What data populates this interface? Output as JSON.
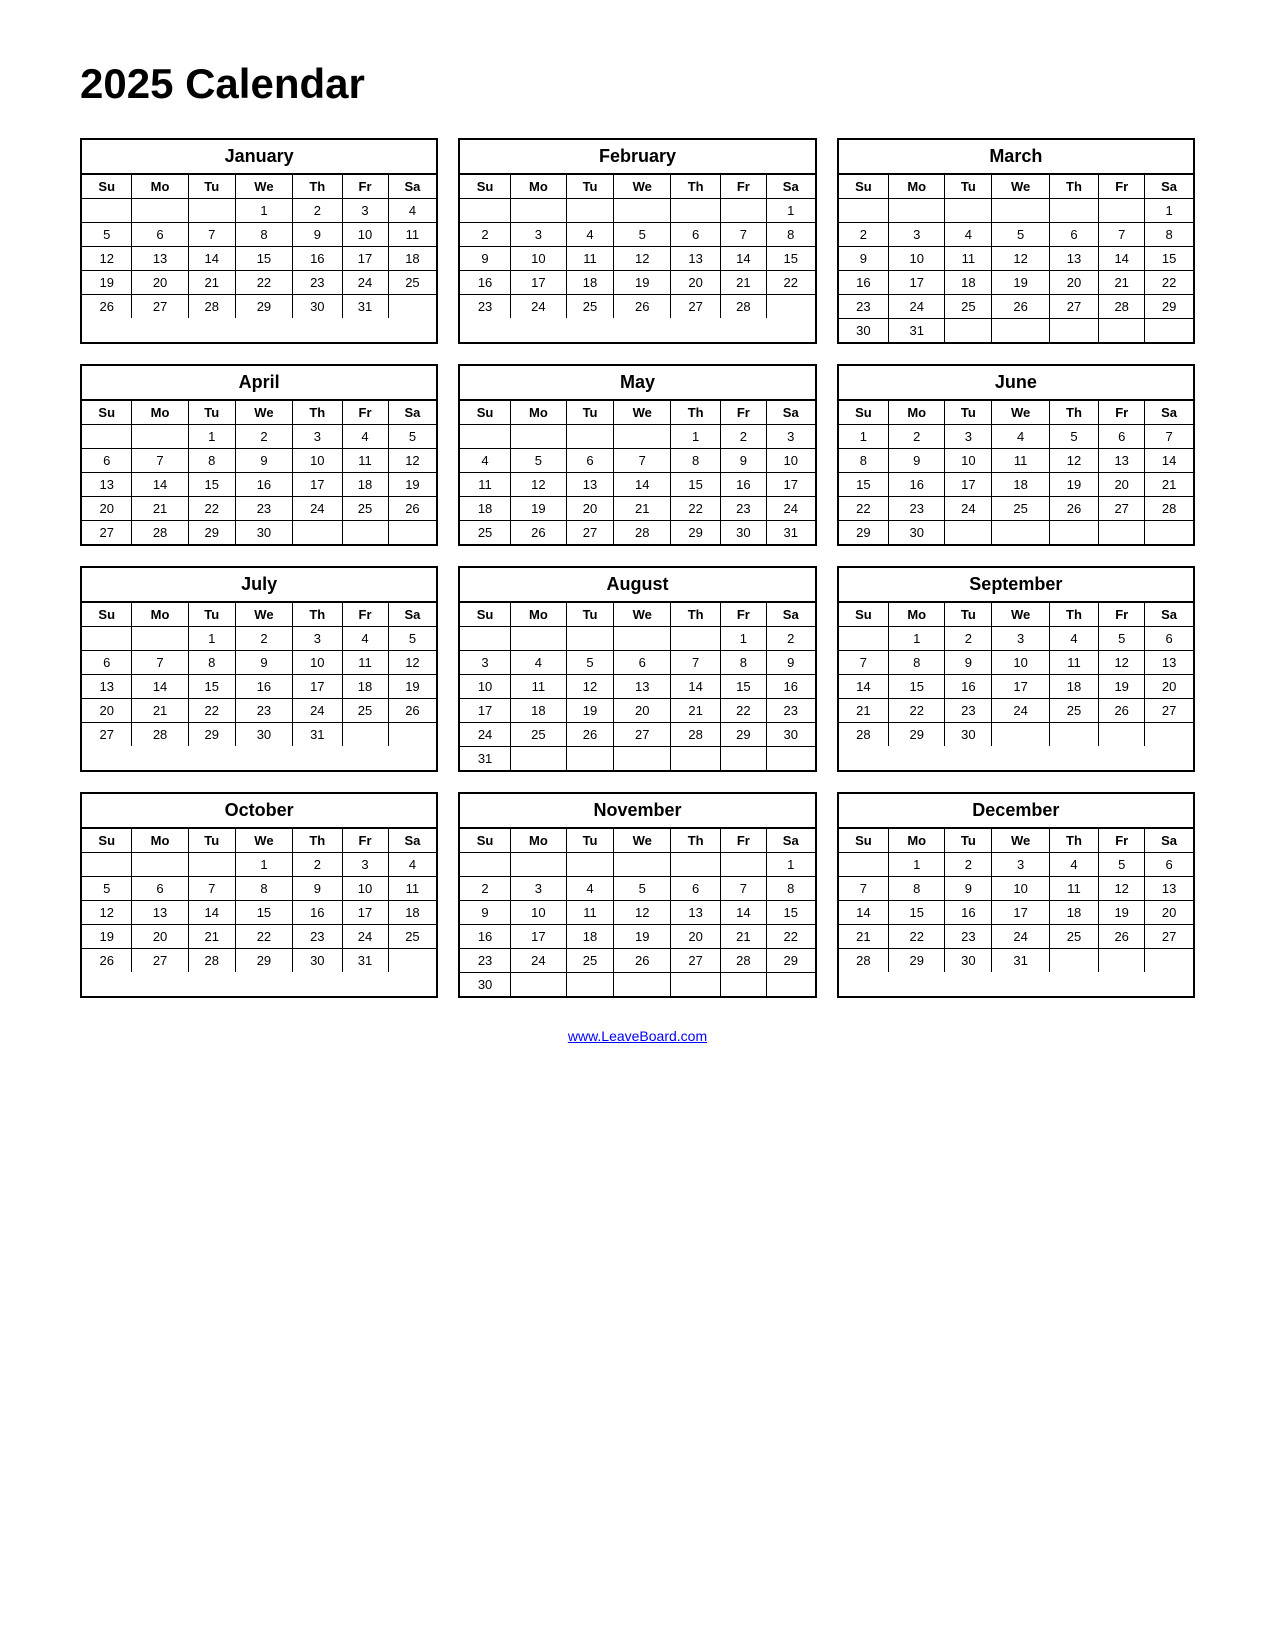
{
  "title": "2025 Calendar",
  "footer": "www.LeaveBoard.com",
  "days": [
    "Su",
    "Mo",
    "Tu",
    "We",
    "Th",
    "Fr",
    "Sa"
  ],
  "months": [
    {
      "name": "January",
      "weeks": [
        [
          "",
          "",
          "",
          "1",
          "2",
          "3",
          "4"
        ],
        [
          "5",
          "6",
          "7",
          "8",
          "9",
          "10",
          "11"
        ],
        [
          "12",
          "13",
          "14",
          "15",
          "16",
          "17",
          "18"
        ],
        [
          "19",
          "20",
          "21",
          "22",
          "23",
          "24",
          "25"
        ],
        [
          "26",
          "27",
          "28",
          "29",
          "30",
          "31",
          ""
        ]
      ]
    },
    {
      "name": "February",
      "weeks": [
        [
          "",
          "",
          "",
          "",
          "",
          "",
          "1"
        ],
        [
          "2",
          "3",
          "4",
          "5",
          "6",
          "7",
          "8"
        ],
        [
          "9",
          "10",
          "11",
          "12",
          "13",
          "14",
          "15"
        ],
        [
          "16",
          "17",
          "18",
          "19",
          "20",
          "21",
          "22"
        ],
        [
          "23",
          "24",
          "25",
          "26",
          "27",
          "28",
          ""
        ]
      ]
    },
    {
      "name": "March",
      "weeks": [
        [
          "",
          "",
          "",
          "",
          "",
          "",
          "1"
        ],
        [
          "2",
          "3",
          "4",
          "5",
          "6",
          "7",
          "8"
        ],
        [
          "9",
          "10",
          "11",
          "12",
          "13",
          "14",
          "15"
        ],
        [
          "16",
          "17",
          "18",
          "19",
          "20",
          "21",
          "22"
        ],
        [
          "23",
          "24",
          "25",
          "26",
          "27",
          "28",
          "29"
        ],
        [
          "30",
          "31",
          "",
          "",
          "",
          "",
          ""
        ]
      ]
    },
    {
      "name": "April",
      "weeks": [
        [
          "",
          "",
          "1",
          "2",
          "3",
          "4",
          "5"
        ],
        [
          "6",
          "7",
          "8",
          "9",
          "10",
          "11",
          "12"
        ],
        [
          "13",
          "14",
          "15",
          "16",
          "17",
          "18",
          "19"
        ],
        [
          "20",
          "21",
          "22",
          "23",
          "24",
          "25",
          "26"
        ],
        [
          "27",
          "28",
          "29",
          "30",
          "",
          "",
          ""
        ]
      ]
    },
    {
      "name": "May",
      "weeks": [
        [
          "",
          "",
          "",
          "",
          "1",
          "2",
          "3"
        ],
        [
          "4",
          "5",
          "6",
          "7",
          "8",
          "9",
          "10"
        ],
        [
          "11",
          "12",
          "13",
          "14",
          "15",
          "16",
          "17"
        ],
        [
          "18",
          "19",
          "20",
          "21",
          "22",
          "23",
          "24"
        ],
        [
          "25",
          "26",
          "27",
          "28",
          "29",
          "30",
          "31"
        ]
      ]
    },
    {
      "name": "June",
      "weeks": [
        [
          "1",
          "2",
          "3",
          "4",
          "5",
          "6",
          "7"
        ],
        [
          "8",
          "9",
          "10",
          "11",
          "12",
          "13",
          "14"
        ],
        [
          "15",
          "16",
          "17",
          "18",
          "19",
          "20",
          "21"
        ],
        [
          "22",
          "23",
          "24",
          "25",
          "26",
          "27",
          "28"
        ],
        [
          "29",
          "30",
          "",
          "",
          "",
          "",
          ""
        ]
      ]
    },
    {
      "name": "July",
      "weeks": [
        [
          "",
          "",
          "1",
          "2",
          "3",
          "4",
          "5"
        ],
        [
          "6",
          "7",
          "8",
          "9",
          "10",
          "11",
          "12"
        ],
        [
          "13",
          "14",
          "15",
          "16",
          "17",
          "18",
          "19"
        ],
        [
          "20",
          "21",
          "22",
          "23",
          "24",
          "25",
          "26"
        ],
        [
          "27",
          "28",
          "29",
          "30",
          "31",
          "",
          ""
        ]
      ]
    },
    {
      "name": "August",
      "weeks": [
        [
          "",
          "",
          "",
          "",
          "",
          "1",
          "2"
        ],
        [
          "3",
          "4",
          "5",
          "6",
          "7",
          "8",
          "9"
        ],
        [
          "10",
          "11",
          "12",
          "13",
          "14",
          "15",
          "16"
        ],
        [
          "17",
          "18",
          "19",
          "20",
          "21",
          "22",
          "23"
        ],
        [
          "24",
          "25",
          "26",
          "27",
          "28",
          "29",
          "30"
        ],
        [
          "31",
          "",
          "",
          "",
          "",
          "",
          ""
        ]
      ]
    },
    {
      "name": "September",
      "weeks": [
        [
          "",
          "1",
          "2",
          "3",
          "4",
          "5",
          "6"
        ],
        [
          "7",
          "8",
          "9",
          "10",
          "11",
          "12",
          "13"
        ],
        [
          "14",
          "15",
          "16",
          "17",
          "18",
          "19",
          "20"
        ],
        [
          "21",
          "22",
          "23",
          "24",
          "25",
          "26",
          "27"
        ],
        [
          "28",
          "29",
          "30",
          "",
          "",
          "",
          ""
        ]
      ]
    },
    {
      "name": "October",
      "weeks": [
        [
          "",
          "",
          "",
          "1",
          "2",
          "3",
          "4"
        ],
        [
          "5",
          "6",
          "7",
          "8",
          "9",
          "10",
          "11"
        ],
        [
          "12",
          "13",
          "14",
          "15",
          "16",
          "17",
          "18"
        ],
        [
          "19",
          "20",
          "21",
          "22",
          "23",
          "24",
          "25"
        ],
        [
          "26",
          "27",
          "28",
          "29",
          "30",
          "31",
          ""
        ]
      ]
    },
    {
      "name": "November",
      "weeks": [
        [
          "",
          "",
          "",
          "",
          "",
          "",
          "1"
        ],
        [
          "2",
          "3",
          "4",
          "5",
          "6",
          "7",
          "8"
        ],
        [
          "9",
          "10",
          "11",
          "12",
          "13",
          "14",
          "15"
        ],
        [
          "16",
          "17",
          "18",
          "19",
          "20",
          "21",
          "22"
        ],
        [
          "23",
          "24",
          "25",
          "26",
          "27",
          "28",
          "29"
        ],
        [
          "30",
          "",
          "",
          "",
          "",
          "",
          ""
        ]
      ]
    },
    {
      "name": "December",
      "weeks": [
        [
          "",
          "1",
          "2",
          "3",
          "4",
          "5",
          "6"
        ],
        [
          "7",
          "8",
          "9",
          "10",
          "11",
          "12",
          "13"
        ],
        [
          "14",
          "15",
          "16",
          "17",
          "18",
          "19",
          "20"
        ],
        [
          "21",
          "22",
          "23",
          "24",
          "25",
          "26",
          "27"
        ],
        [
          "28",
          "29",
          "30",
          "31",
          "",
          "",
          ""
        ]
      ]
    }
  ]
}
